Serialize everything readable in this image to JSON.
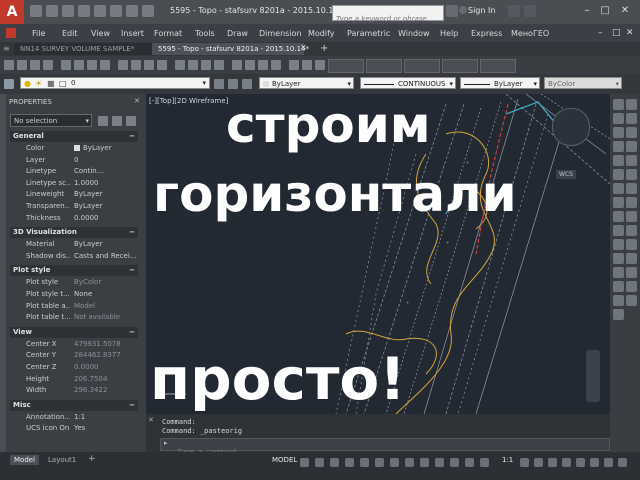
{
  "titlebar": {
    "logo": "A",
    "title": "5595 - Topo - stafsurv 8201a - 2015.10.14...",
    "search_placeholder": "Type a keyword or phrase",
    "signin": "Sign In"
  },
  "menu": [
    "File",
    "Edit",
    "View",
    "Insert",
    "Format",
    "Tools",
    "Draw",
    "Dimension",
    "Modify",
    "Parametric",
    "Window",
    "Help",
    "Express",
    "МеноГЕО"
  ],
  "tabs": {
    "inactive": "NN14 SURVEY VOLUME SAMPLE*",
    "active": "5595 - Topo - stafsurv 8201a - 2015.10.14*",
    "add": "+"
  },
  "toolbar": {
    "layer": "0",
    "color": "ByLayer",
    "linetype": "CONTINUOUS",
    "lineweight": "ByLayer",
    "plotstyle": "ByColor"
  },
  "properties": {
    "title": "PROPERTIES",
    "selection": "No selection",
    "sections": [
      {
        "name": "General",
        "rows": [
          [
            "Color",
            "ByLayer"
          ],
          [
            "Layer",
            "0"
          ],
          [
            "Linetype",
            "Contin..."
          ],
          [
            "Linetype sc...",
            "1.0000"
          ],
          [
            "Lineweight",
            "ByLayer"
          ],
          [
            "Transparen...",
            "ByLayer"
          ],
          [
            "Thickness",
            "0.0000"
          ]
        ]
      },
      {
        "name": "3D Visualization",
        "rows": [
          [
            "Material",
            "ByLayer"
          ],
          [
            "Shadow dis...",
            "Casts and Recei..."
          ]
        ]
      },
      {
        "name": "Plot style",
        "rows": [
          [
            "Plot style",
            "ByColor"
          ],
          [
            "Plot style t...",
            "None"
          ],
          [
            "Plot table a...",
            "Model"
          ],
          [
            "Plot table t...",
            "Not available"
          ]
        ]
      },
      {
        "name": "View",
        "rows": [
          [
            "Center X",
            "479931.5078"
          ],
          [
            "Center Y",
            "284462.8377"
          ],
          [
            "Center Z",
            "0.0000"
          ],
          [
            "Height",
            "206.7504"
          ],
          [
            "Width",
            "296.3422"
          ]
        ]
      },
      {
        "name": "Misc",
        "rows": [
          [
            "Annotation...",
            "1:1"
          ],
          [
            "UCS icon On",
            "Yes"
          ]
        ]
      }
    ]
  },
  "viewport": {
    "label": "[-][Top][2D Wireframe]",
    "wcs": "WCS"
  },
  "overlay": {
    "line1": "строим",
    "line2": "горизонтали",
    "line3": "просто!"
  },
  "command": {
    "line1": "Command:",
    "line2": "Command: _pasteorig",
    "placeholder": "Type a command"
  },
  "status": {
    "tab_model": "Model",
    "tab_layout": "Layout1",
    "model_label": "MODEL",
    "scale": "1:1"
  }
}
